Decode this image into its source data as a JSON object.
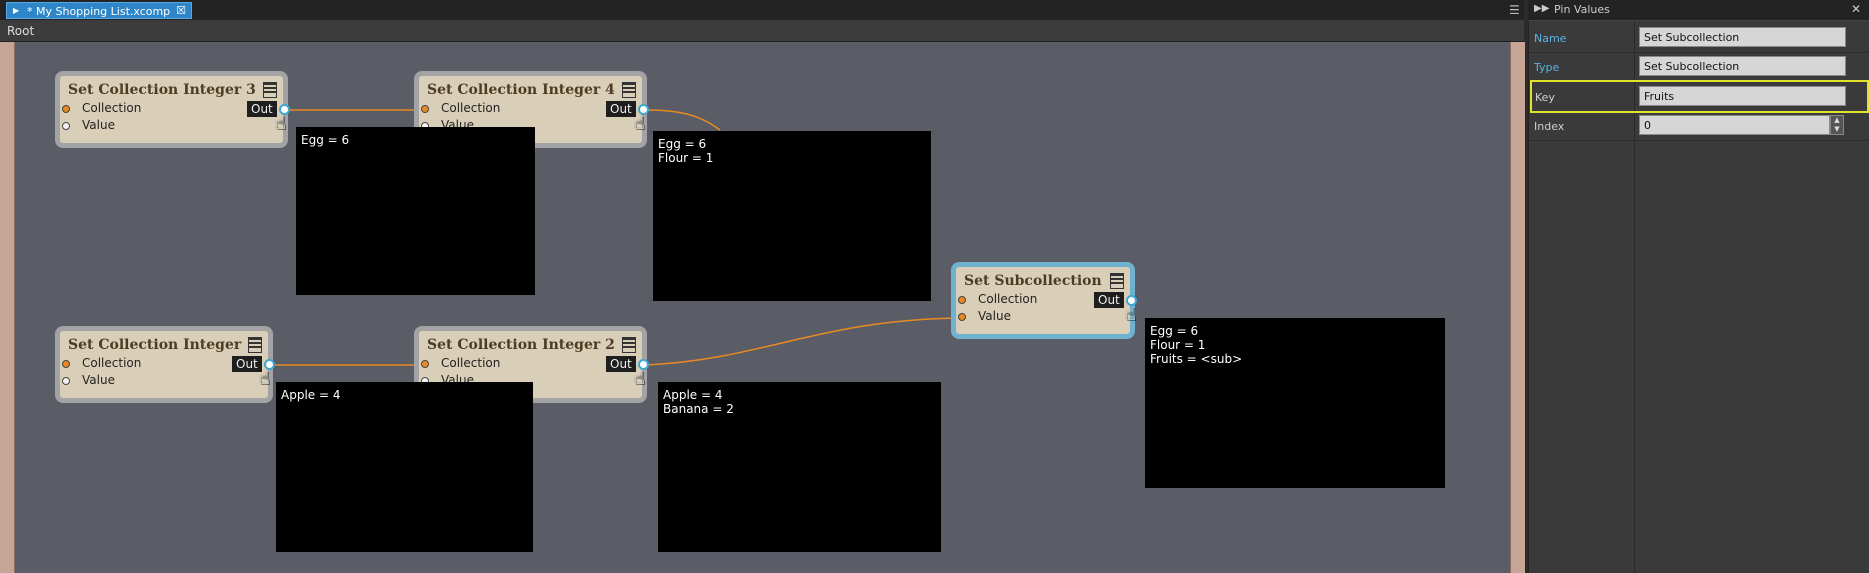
{
  "tab": {
    "title": "* My Shopping List.xcomp",
    "close": "☒"
  },
  "breadcrumb": "Root",
  "nodes": {
    "sci3": {
      "title": "Set Collection Integer 3",
      "pin1": "Collection",
      "pin2": "Value",
      "out": "Out"
    },
    "sci4": {
      "title": "Set Collection Integer 4",
      "pin1": "Collection",
      "pin2": "Value",
      "out": "Out"
    },
    "sci": {
      "title": "Set Collection Integer",
      "pin1": "Collection",
      "pin2": "Value",
      "out": "Out"
    },
    "sci2": {
      "title": "Set Collection Integer 2",
      "pin1": "Collection",
      "pin2": "Value",
      "out": "Out"
    },
    "ssub": {
      "title": "Set Subcollection",
      "pin1": "Collection",
      "pin2": "Value",
      "out": "Out"
    }
  },
  "tooltips": {
    "t1": [
      "Egg = 6"
    ],
    "t2": [
      "Egg = 6",
      "Flour = 1"
    ],
    "t3": [
      "Apple = 4"
    ],
    "t4": [
      "Apple = 4",
      "Banana = 2"
    ],
    "t5": [
      "Egg = 6",
      "Flour = 1",
      "Fruits = <sub>"
    ]
  },
  "panel": {
    "title": "Pin Values",
    "rows": [
      {
        "label": "Name",
        "value": "Set Subcollection",
        "label_color": "#5ab4e6"
      },
      {
        "label": "Type",
        "value": "Set Subcollection",
        "label_color": "#5ab4e6"
      },
      {
        "label": "Key",
        "value": "Fruits",
        "label_color": "#cfcfcf"
      },
      {
        "label": "Index",
        "value": "0",
        "label_color": "#cfcfcf"
      }
    ]
  },
  "colors": {
    "accent": "#2e86c8",
    "wire": "#e88a22",
    "highlight": "#e3e22a",
    "selected_node": "#6fb2d0"
  },
  "icons": {
    "tab_arrow": "triangle-right-icon",
    "menu": "list-icon",
    "node_menu": "node-menu-icon",
    "cursor": "hand-pointer-icon",
    "collapse": "double-chevron-icon",
    "close": "close-icon"
  }
}
